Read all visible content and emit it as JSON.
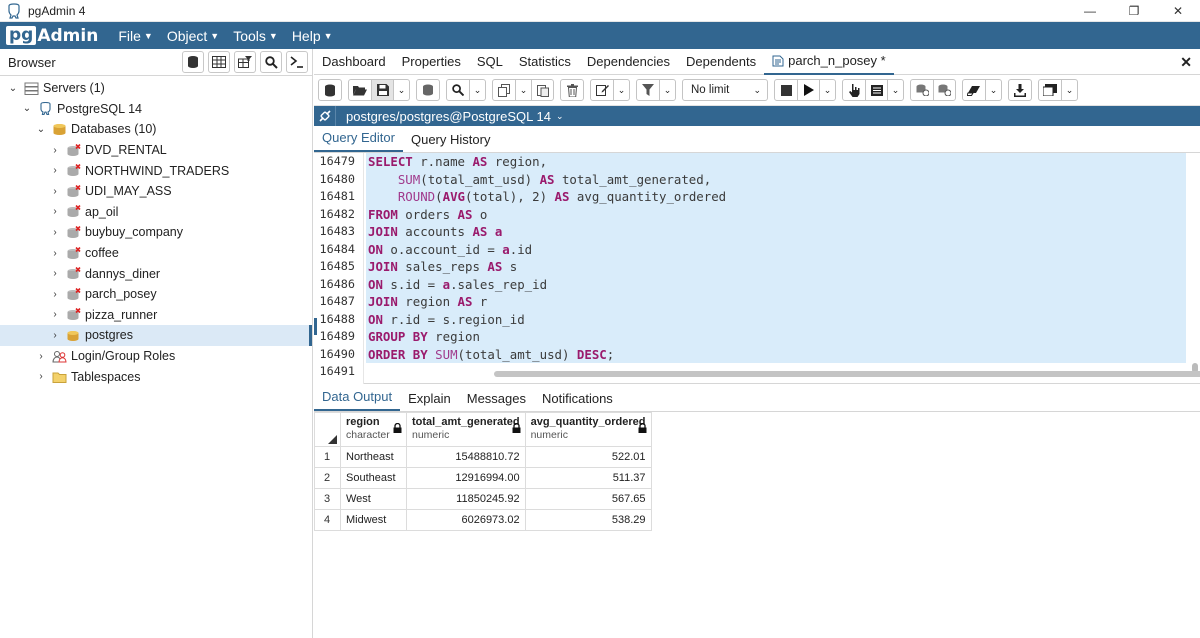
{
  "window": {
    "title": "pgAdmin 4",
    "controls": [
      "—",
      "❐",
      "✕"
    ]
  },
  "menubar": {
    "logo_pg": "pg",
    "logo_admin": "Admin",
    "items": [
      {
        "label": "File"
      },
      {
        "label": "Object"
      },
      {
        "label": "Tools"
      },
      {
        "label": "Help"
      }
    ]
  },
  "browser": {
    "title": "Browser",
    "tree": [
      {
        "label": "Servers (1)",
        "chevron": "⌄",
        "icon": "servers-icon"
      },
      {
        "label": "PostgreSQL 14",
        "chevron": "⌄",
        "icon": "postgres-server-icon"
      },
      {
        "label": "Databases (10)",
        "chevron": "⌄",
        "icon": "databases-icon"
      },
      {
        "label": "DVD_RENTAL",
        "chevron": "›",
        "icon": "database-icon"
      },
      {
        "label": "NORTHWIND_TRADERS",
        "chevron": "›",
        "icon": "database-icon"
      },
      {
        "label": "UDI_MAY_ASS",
        "chevron": "›",
        "icon": "database-icon"
      },
      {
        "label": "ap_oil",
        "chevron": "›",
        "icon": "database-icon"
      },
      {
        "label": "buybuy_company",
        "chevron": "›",
        "icon": "database-icon"
      },
      {
        "label": "coffee",
        "chevron": "›",
        "icon": "database-icon"
      },
      {
        "label": "dannys_diner",
        "chevron": "›",
        "icon": "database-icon"
      },
      {
        "label": "parch_posey",
        "chevron": "›",
        "icon": "database-icon"
      },
      {
        "label": "pizza_runner",
        "chevron": "›",
        "icon": "database-icon"
      },
      {
        "label": "postgres",
        "chevron": "›",
        "icon": "database-connected-icon"
      },
      {
        "label": "Login/Group Roles",
        "chevron": "›",
        "icon": "roles-icon"
      },
      {
        "label": "Tablespaces",
        "chevron": "›",
        "icon": "tablespaces-icon"
      }
    ]
  },
  "tabs": [
    {
      "label": "Dashboard"
    },
    {
      "label": "Properties"
    },
    {
      "label": "SQL"
    },
    {
      "label": "Statistics"
    },
    {
      "label": "Dependencies"
    },
    {
      "label": "Dependents"
    },
    {
      "label": "parch_n_posey *"
    }
  ],
  "close_label": "✕",
  "query_toolbar": {
    "limit_label": "No limit"
  },
  "connection": {
    "label": "postgres/postgres@PostgreSQL 14"
  },
  "editor_tabs": [
    {
      "label": "Query Editor"
    },
    {
      "label": "Query History"
    }
  ],
  "editor": {
    "line_numbers": [
      "16479",
      "16480",
      "16481",
      "16482",
      "16483",
      "16484",
      "16485",
      "16486",
      "16487",
      "16488",
      "16489",
      "16490",
      "16491"
    ]
  },
  "output_tabs": [
    {
      "label": "Data Output"
    },
    {
      "label": "Explain"
    },
    {
      "label": "Messages"
    },
    {
      "label": "Notifications"
    }
  ],
  "results": {
    "columns": [
      {
        "name": "region",
        "type": "character"
      },
      {
        "name": "total_amt_generated",
        "type": "numeric"
      },
      {
        "name": "avg_quantity_ordered",
        "type": "numeric"
      }
    ],
    "rows": [
      {
        "n": "1",
        "region": "Northeast",
        "total": "15488810.72",
        "avg": "522.01"
      },
      {
        "n": "2",
        "region": "Southeast",
        "total": "12916994.00",
        "avg": "511.37"
      },
      {
        "n": "3",
        "region": "West",
        "total": "11850245.92",
        "avg": "567.65"
      },
      {
        "n": "4",
        "region": "Midwest",
        "total": "6026973.02",
        "avg": "538.29"
      }
    ]
  }
}
